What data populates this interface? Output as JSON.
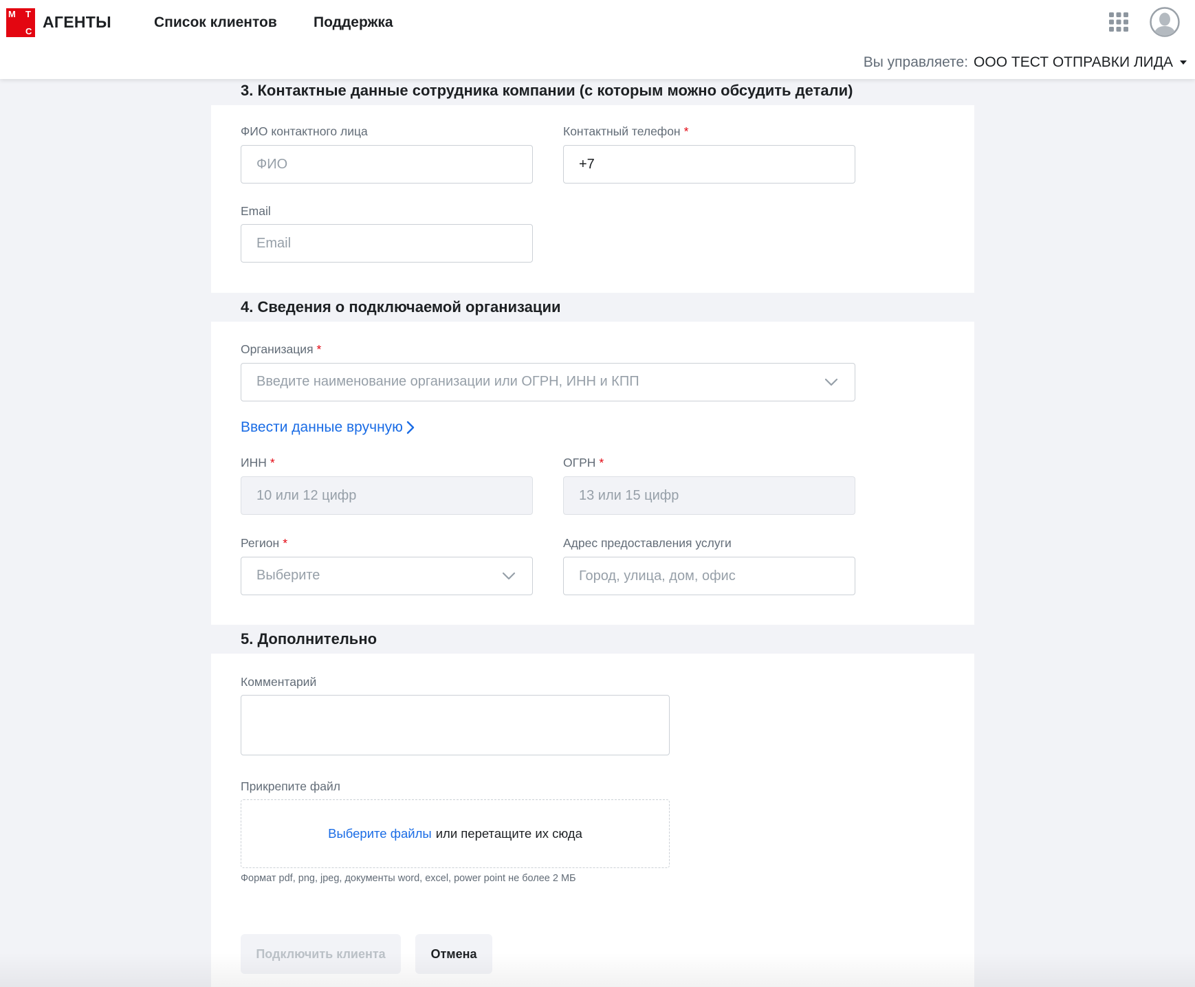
{
  "header": {
    "logo_letters": [
      "М",
      "Т",
      "С"
    ],
    "brand": "АГЕНТЫ",
    "nav": [
      {
        "label": "Список клиентов"
      },
      {
        "label": "Поддержка"
      }
    ],
    "manage_label": "Вы управляете:",
    "manage_org": "ООО ТЕСТ ОТПРАВКИ ЛИДА",
    "icons": [
      "apps-grid-icon",
      "user-avatar-icon",
      "caret-down-icon"
    ]
  },
  "main": {
    "sections": [
      {
        "title": "3. Контактные данные сотрудника компании (с которым можно обсудить детали)"
      },
      {
        "title": "4. Сведения о подключаемой организации"
      },
      {
        "title": "5. Дополнительно"
      }
    ],
    "contact": {
      "fio": {
        "label": "ФИО контактного лица",
        "placeholder": "ФИО",
        "value": ""
      },
      "phone": {
        "label": "Контактный телефон",
        "required": "*",
        "value": "+7"
      },
      "email": {
        "label": "Email",
        "placeholder": "Email",
        "value": ""
      }
    },
    "organization": {
      "org": {
        "label": "Организация",
        "required": "*",
        "placeholder": "Введите наименование организации или ОГРН, ИНН и КПП"
      },
      "manual_link": "Ввести данные вручную",
      "inn": {
        "label": "ИНН",
        "required": "*",
        "placeholder": "10 или 12 цифр"
      },
      "ogrn": {
        "label": "ОГРН",
        "required": "*",
        "placeholder": "13 или 15 цифр"
      },
      "region": {
        "label": "Регион",
        "required": "*",
        "placeholder": "Выберите"
      },
      "address": {
        "label": "Адрес предоставления услуги",
        "placeholder": "Город, улица, дом, офис"
      }
    },
    "additional": {
      "comment_label": "Комментарий",
      "attach_label": "Прикрепите файл",
      "choose_files": "Выберите файлы",
      "drop_text": "или перетащите их сюда",
      "format_hint": "Формат pdf, png, jpeg, документы word, excel, power point не более 2 МБ"
    },
    "buttons": {
      "submit": "Подключить клиента",
      "cancel": "Отмена"
    }
  },
  "colors": {
    "brand_red": "#e30611",
    "link_blue": "#1a6ce5",
    "page_bg": "#f2f3f7",
    "text": "#1d2023",
    "muted": "#626c77"
  }
}
